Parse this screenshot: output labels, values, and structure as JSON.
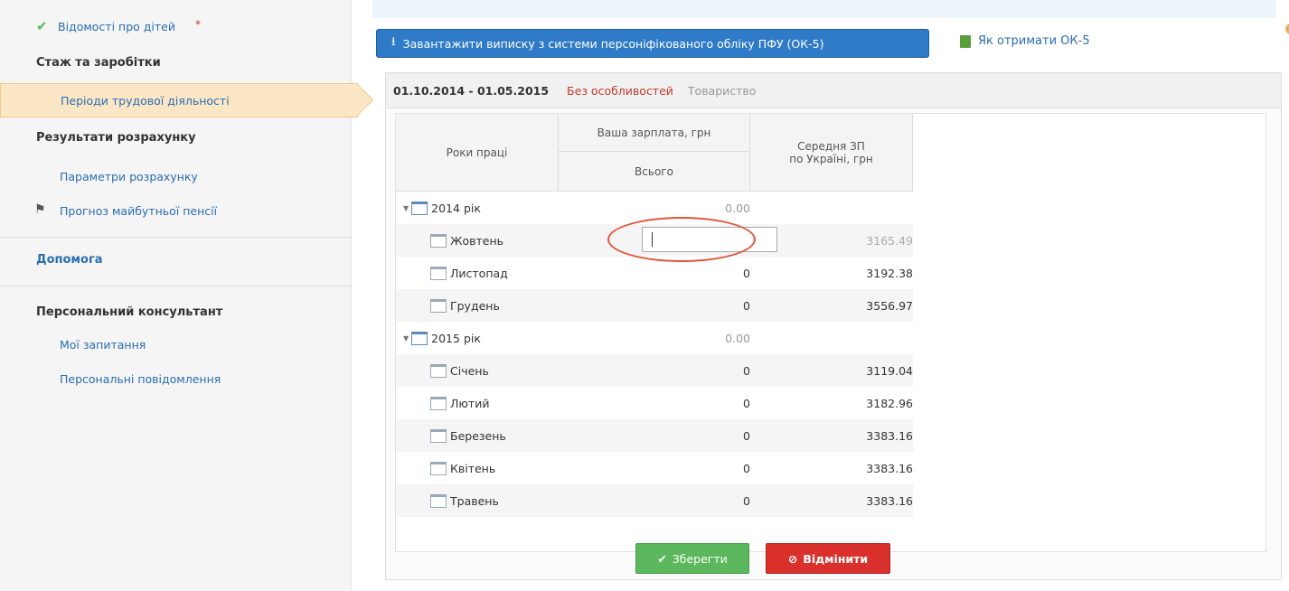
{
  "sidebar": {
    "children_info": "Відомості про дітей",
    "required_mark": "*",
    "section_experience": "Стаж та заробітки",
    "work_periods": "Періоди трудової діяльності",
    "section_results": "Результати розрахунку",
    "calc_params": "Параметри розрахунку",
    "pension_forecast": "Прогноз майбутньої пенсії",
    "help": "Допомога",
    "section_consultant": "Персональний консультант",
    "my_questions": "Мої запитання",
    "personal_messages": "Персональні повідомлення"
  },
  "toolbar": {
    "import_label": "Завантажити виписку з системи персоніфікованого обліку ПФУ (ОК-5)",
    "howto_label": "Як отримати ОК-5"
  },
  "panel": {
    "period": "01.10.2014 - 01.05.2015",
    "feature": "Без особливостей",
    "organization": "Товариство"
  },
  "table": {
    "col_years": "Роки праці",
    "col_salary": "Ваша зарплата, грн",
    "col_total": "Всього",
    "col_avg_line1": "Середня ЗП",
    "col_avg_line2": "по Україні, грн",
    "rows": [
      {
        "label": "2014 рік",
        "value": "0.00",
        "avg": ""
      },
      {
        "label": "Жовтень",
        "value": "",
        "avg": "3165.49"
      },
      {
        "label": "Листопад",
        "value": "0",
        "avg": "3192.38"
      },
      {
        "label": "Грудень",
        "value": "0",
        "avg": "3556.97"
      },
      {
        "label": "2015 рік",
        "value": "0.00",
        "avg": ""
      },
      {
        "label": "Січень",
        "value": "0",
        "avg": "3119.04"
      },
      {
        "label": "Лютий",
        "value": "0",
        "avg": "3182.96"
      },
      {
        "label": "Березень",
        "value": "0",
        "avg": "3383.16"
      },
      {
        "label": "Квітень",
        "value": "0",
        "avg": "3383.16"
      },
      {
        "label": "Травень",
        "value": "0",
        "avg": "3383.16"
      }
    ]
  },
  "actions": {
    "save_label": "Зберегти",
    "cancel_label": "Відмінити"
  },
  "colors": {
    "primary": "#2f7bc7",
    "success": "#5cb85c",
    "danger": "#d9302c",
    "link": "#2a6db0",
    "active_bg": "#fbe7c6"
  },
  "icons": {
    "check": "check-icon",
    "flag": "flag-icon",
    "upload": "upload-icon",
    "document": "document-icon",
    "calendar": "calendar-icon",
    "ban": "ban-icon"
  }
}
